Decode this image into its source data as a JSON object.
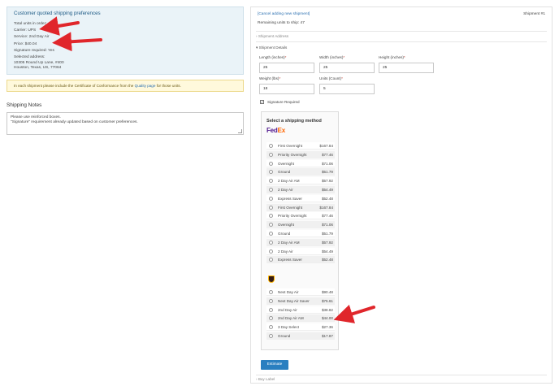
{
  "prefs": {
    "title": "Customer quoted shipping preferences",
    "total_units": "Total units in order: 47",
    "carrier": "Carrier: UPS",
    "service": "Service: 2nd Day Air",
    "price": "Price: $40.04",
    "signature": "Signature required: Yes",
    "address_label": "Selected address:",
    "address_line1": "10305 Round Up Lane, #400",
    "address_line2": "Houston, Texas, US, 77064"
  },
  "notice": {
    "before": "In each shipment please include the Certificate of Conformance from the ",
    "link": "Quality page",
    "after": " for those units."
  },
  "notes": {
    "label": "Shipping Notes",
    "line1": "Please use reinforced boxes.",
    "line2": "\"Signature\" requirement already updated based on customer preferences."
  },
  "shipment": {
    "cancel_link": "[Cancel adding new shipment]",
    "number": "Shipment #1",
    "remaining": "Remaining units to ship: 47",
    "address_section": "Shipment Address",
    "details_section": "Shipment Details",
    "length_label": "Length (inches)",
    "length_value": "25",
    "width_label": "Width (inches)",
    "width_value": "25",
    "height_label": "Height (inches)",
    "height_value": "25",
    "weight_label": "Weight (lbs)",
    "weight_value": "18",
    "units_label": "Units (Count)",
    "units_value": "5",
    "signature_label": "Signature Required",
    "signature_checked": "✓",
    "required_mark": "*",
    "estimate_button": "Estimate",
    "buy_label_section": "Buy Label"
  },
  "shipping_method": {
    "title": "Select a shipping method",
    "fedex_logo_fe": "Fed",
    "fedex_logo_ex": "Ex",
    "fedex_options": [
      {
        "name": "First Overnight",
        "price": "$167.84"
      },
      {
        "name": "Priority Overnight",
        "price": "$77.46"
      },
      {
        "name": "Overnight",
        "price": "$71.06"
      },
      {
        "name": "Ground",
        "price": "$51.79"
      },
      {
        "name": "2 Day Air AM",
        "price": "$57.92"
      },
      {
        "name": "2 Day Air",
        "price": "$54.49"
      },
      {
        "name": "Express Saver",
        "price": "$52.48"
      },
      {
        "name": "First Overnight",
        "price": "$167.84"
      },
      {
        "name": "Priority Overnight",
        "price": "$77.46"
      },
      {
        "name": "Overnight",
        "price": "$71.06"
      },
      {
        "name": "Ground",
        "price": "$51.79"
      },
      {
        "name": "2 Day Air AM",
        "price": "$57.92"
      },
      {
        "name": "2 Day Air",
        "price": "$54.49"
      },
      {
        "name": "Express Saver",
        "price": "$52.48"
      }
    ],
    "ups_options": [
      {
        "name": "Next Day Air",
        "price": "$90.48"
      },
      {
        "name": "Next Day Air Saver",
        "price": "$75.61"
      },
      {
        "name": "2nd Day Air",
        "price": "$38.82"
      },
      {
        "name": "2nd Day Air AM",
        "price": "$44.00"
      },
      {
        "name": "3 Day Select",
        "price": "$27.36"
      },
      {
        "name": "Ground",
        "price": "$17.87"
      }
    ]
  },
  "colors": {
    "annotation_arrow": "#e0262b",
    "link_blue": "#2a6fb0",
    "button_blue": "#2a7fc0"
  }
}
